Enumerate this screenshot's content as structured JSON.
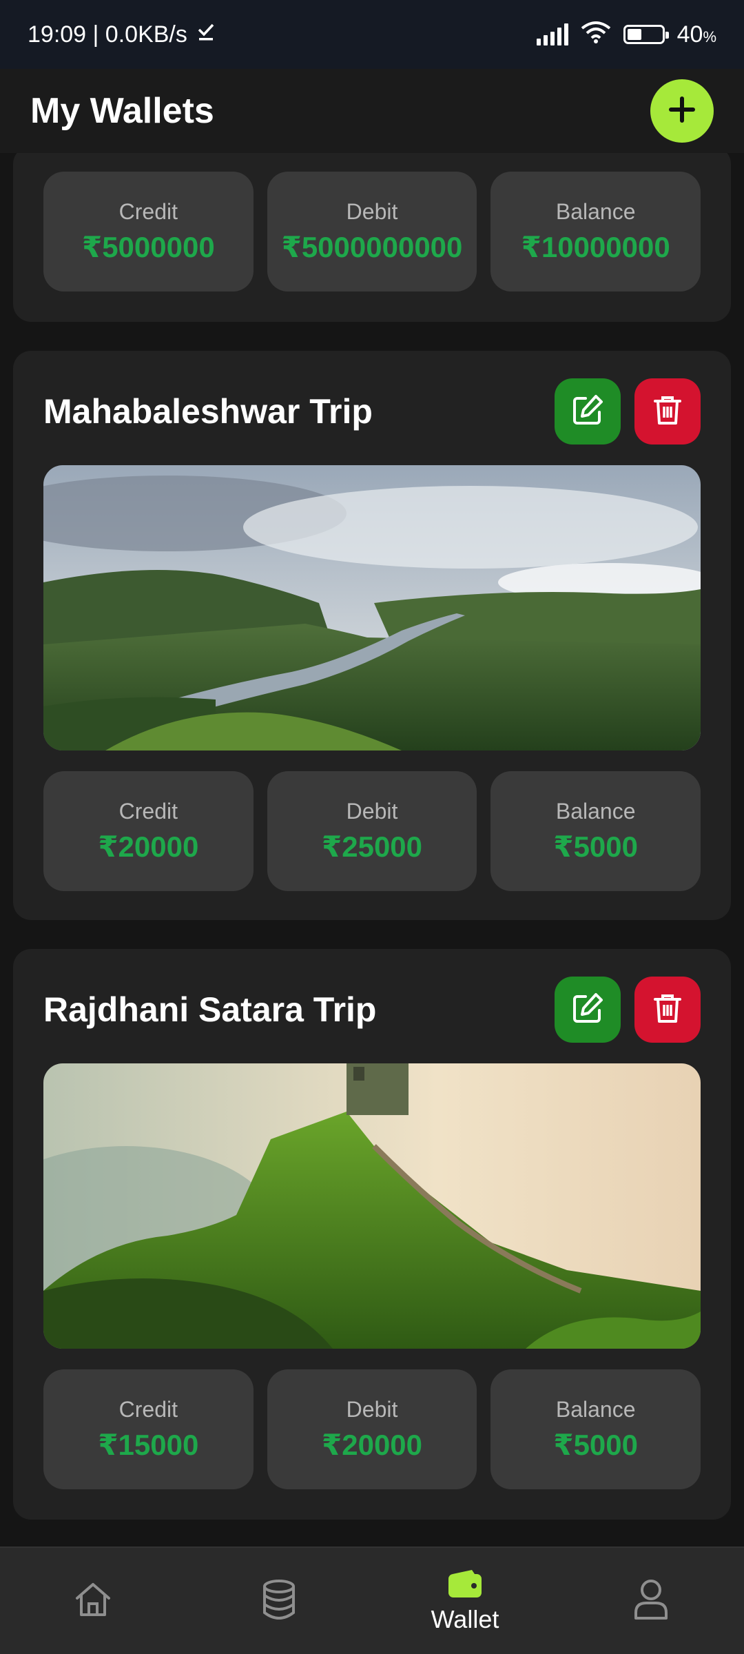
{
  "status": {
    "time_net": "19:09 | 0.0KB/s",
    "battery_pct": "40",
    "battery_unit": "%"
  },
  "header": {
    "title": "My Wallets"
  },
  "wallets": [
    {
      "title": "",
      "stats": [
        {
          "label": "Credit",
          "value": "₹5000000"
        },
        {
          "label": "Debit",
          "value": "₹5000000000"
        },
        {
          "label": "Balance",
          "value": "₹10000000"
        }
      ]
    },
    {
      "title": "Mahabaleshwar Trip",
      "stats": [
        {
          "label": "Credit",
          "value": "₹20000"
        },
        {
          "label": "Debit",
          "value": "₹25000"
        },
        {
          "label": "Balance",
          "value": "₹5000"
        }
      ]
    },
    {
      "title": "Rajdhani Satara Trip",
      "stats": [
        {
          "label": "Credit",
          "value": "₹15000"
        },
        {
          "label": "Debit",
          "value": "₹20000"
        },
        {
          "label": "Balance",
          "value": "₹5000"
        }
      ]
    }
  ],
  "nav": {
    "items": [
      {
        "icon": "home-icon",
        "label": ""
      },
      {
        "icon": "database-icon",
        "label": ""
      },
      {
        "icon": "wallet-icon",
        "label": "Wallet"
      },
      {
        "icon": "profile-icon",
        "label": ""
      }
    ]
  },
  "colors": {
    "accent": "#a6e93a",
    "edit": "#1f8c26",
    "delete": "#d4132f",
    "amount": "#1ea84b"
  }
}
